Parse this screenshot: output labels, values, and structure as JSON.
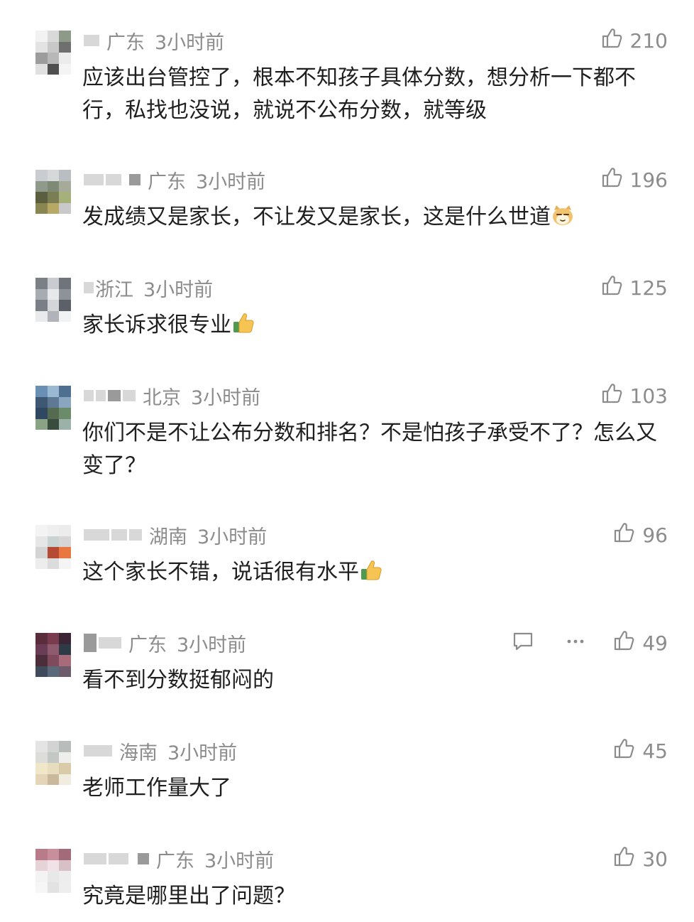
{
  "comments": [
    {
      "location": "广东",
      "time": "3小时前",
      "likes": "210",
      "text": "应该出台管控了，根本不知孩子具体分数，想分析一下都不行，私找也没说，就说不公布分数，就等级",
      "emoji": "",
      "avatar_colors": [
        "#f2f2f2",
        "#d9d9d9",
        "#8d9a88",
        "#e3e3e3",
        "#c8c8c8",
        "#6f6f6f",
        "#9c9c9c",
        "#b8b8b8",
        "#ececec",
        "#e0e0e0",
        "#4f4f4f",
        "#f4f4f4"
      ]
    },
    {
      "location": "广东",
      "time": "3小时前",
      "likes": "196",
      "text": "发成绩又是家长，不让发又是家长，这是什么世道",
      "emoji": "cat-emoji-icon",
      "avatar_colors": [
        "#c9ccd0",
        "#d6d8da",
        "#b9bec2",
        "#8f9a8a",
        "#7c8a76",
        "#a5ab98",
        "#5b5f3f",
        "#7b7d52",
        "#a6b07a",
        "#8a8652",
        "#b7a865",
        "#c9c9c9"
      ]
    },
    {
      "location": "浙江",
      "time": "3小时前",
      "likes": "125",
      "text": "家长诉求很专业",
      "emoji": "thumbs-up-emoji-icon",
      "avatar_colors": [
        "#7b7f86",
        "#c9cbd0",
        "#6f737b",
        "#a7abb2",
        "#e7e8ea",
        "#8e9299",
        "#7a7e86",
        "#d3d5d9",
        "#5c6068",
        "#e9eaec",
        "#b0b3b9",
        "#f1f2f3"
      ]
    },
    {
      "location": "北京",
      "time": "3小时前",
      "likes": "103",
      "text": "你们不是不让公布分数和排名？不是怕孩子承受不了？怎么又变了？",
      "emoji": "",
      "avatar_colors": [
        "#6a8fb5",
        "#9bb8d2",
        "#4f6f91",
        "#3e5874",
        "#5d7994",
        "#89a6be",
        "#2f4760",
        "#546b52",
        "#6c8b6a",
        "#8aa384",
        "#3a4c3d",
        "#9cb2a8"
      ]
    },
    {
      "location": "湖南",
      "time": "3小时前",
      "likes": "96",
      "text": "这个家长不错，说话很有水平",
      "emoji": "thumbs-up-emoji-icon",
      "avatar_colors": [
        "#f3f3f3",
        "#efefef",
        "#ececec",
        "#e6e6e6",
        "#c9d3d1",
        "#d6d6d6",
        "#d4d4d4",
        "#b54b34",
        "#e8783f",
        "#ededed",
        "#dcdcdc",
        "#f4f4f4"
      ]
    },
    {
      "location": "广东",
      "time": "3小时前",
      "likes": "49",
      "text": "看不到分数挺郁闷的",
      "emoji": "",
      "avatar_colors": [
        "#5a2d3c",
        "#7a3b4f",
        "#3b2534",
        "#6b3c55",
        "#8e5a6d",
        "#2e3b46",
        "#4c2d3a",
        "#7f4a5e",
        "#a86b7a",
        "#3f4a5a",
        "#5b6a7a",
        "#6d5a6a"
      ]
    },
    {
      "location": "海南",
      "time": "3小时前",
      "likes": "45",
      "text": "老师工作量大了",
      "emoji": "",
      "avatar_colors": [
        "#e4e4e4",
        "#d1d4d2",
        "#b8bdb9",
        "#dcdcd9",
        "#c4c8c4",
        "#eeeeea",
        "#f0e6c8",
        "#e8dcc0",
        "#d9cba7",
        "#e5d5b8",
        "#c9b99a",
        "#f1ece0"
      ]
    },
    {
      "location": "广东",
      "time": "3小时前",
      "likes": "30",
      "text": "究竟是哪里出了问题？",
      "emoji": "",
      "avatar_colors": [
        "#b97b8a",
        "#c98e9b",
        "#a36a79",
        "#e6d3d8",
        "#f0e2e6",
        "#d7c1c7",
        "#f3f3f3",
        "#e8e8e8",
        "#ededed",
        "#f6f6f6",
        "#e2e2e2",
        "#eeeeee"
      ]
    }
  ],
  "icons": {
    "like": "thumbs-up-outline-icon",
    "reply": "comment-bubble-icon",
    "more": "more-dots-icon"
  },
  "colors": {
    "meta_text": "#8c8c8c",
    "body_text": "#1f1f1f",
    "background": "#ffffff"
  }
}
